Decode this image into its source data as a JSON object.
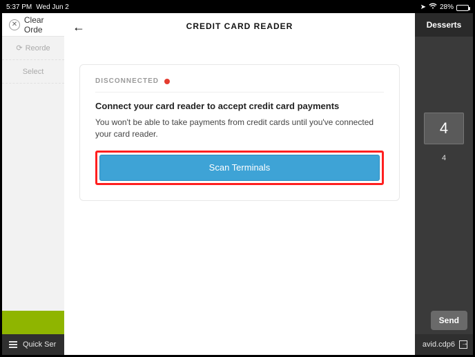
{
  "statusbar": {
    "time": "5:37 PM",
    "date": "Wed Jun 2",
    "battery_pct": "28%"
  },
  "background": {
    "clear_order": "Clear Orde",
    "reorder": "Reorde",
    "select": "Select",
    "quick_service": "Quick Ser",
    "desserts_tab": "Desserts",
    "tile_value": "4",
    "tile_label": "4",
    "send": "Send",
    "user": "avid.cdp6"
  },
  "sheet": {
    "title": "CREDIT CARD READER",
    "status_label": "DISCONNECTED",
    "heading": "Connect your card reader to accept credit card payments",
    "body": "You won't be able to take payments from credit cards until you've connected your card reader.",
    "cta": "Scan Terminals"
  }
}
